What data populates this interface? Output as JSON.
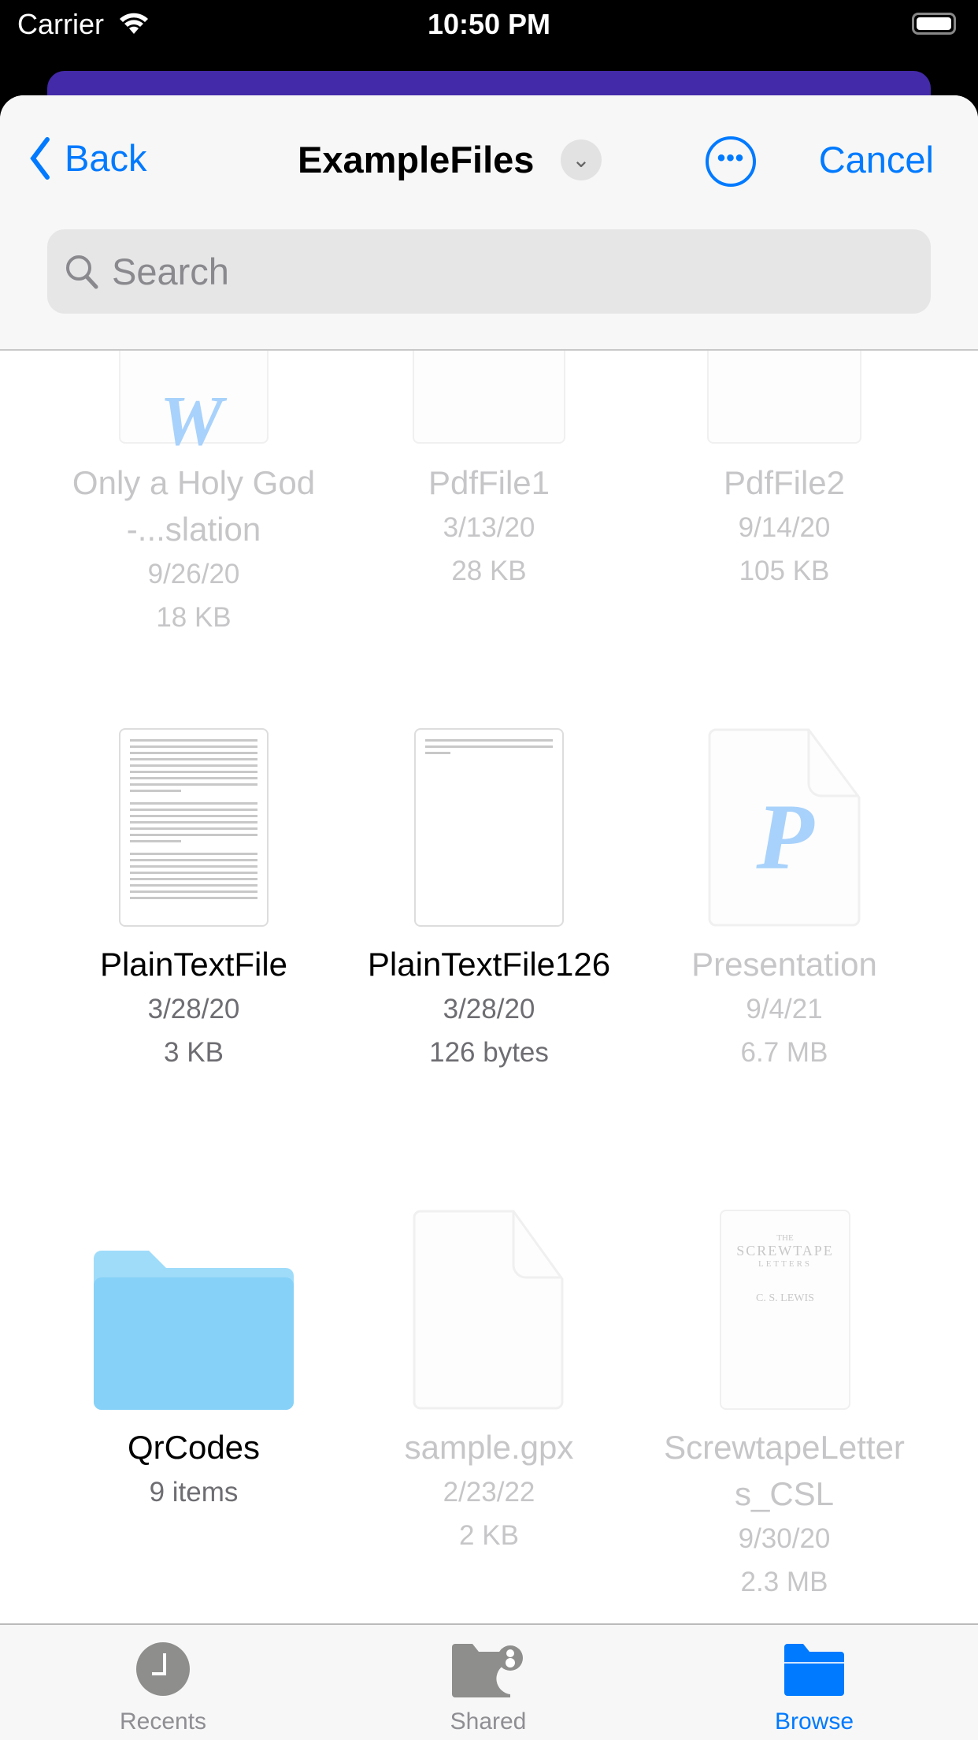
{
  "status": {
    "carrier": "Carrier",
    "time": "10:50 PM"
  },
  "header": {
    "back_label": "Back",
    "title": "ExampleFiles",
    "cancel_label": "Cancel",
    "more_icon": "ellipsis-circle-icon"
  },
  "search": {
    "placeholder": "Search",
    "value": ""
  },
  "files": [
    {
      "name": "Only a Holy God -...slation",
      "date": "9/26/20",
      "size": "18 KB",
      "enabled": false,
      "kind": "word"
    },
    {
      "name": "PdfFile1",
      "date": "3/13/20",
      "size": "28 KB",
      "enabled": false,
      "kind": "pdf"
    },
    {
      "name": "PdfFile2",
      "date": "9/14/20",
      "size": "105 KB",
      "enabled": false,
      "kind": "pdf"
    },
    {
      "name": "PlainTextFile",
      "date": "3/28/20",
      "size": "3 KB",
      "enabled": true,
      "kind": "text"
    },
    {
      "name": "PlainTextFile126",
      "date": "3/28/20",
      "size": "126 bytes",
      "enabled": true,
      "kind": "text"
    },
    {
      "name": "Presentation",
      "date": "9/4/21",
      "size": "6.7 MB",
      "enabled": false,
      "kind": "keynote"
    },
    {
      "name": "QrCodes",
      "items": "9 items",
      "enabled": true,
      "kind": "folder"
    },
    {
      "name": "sample.gpx",
      "date": "2/23/22",
      "size": "2 KB",
      "enabled": false,
      "kind": "generic"
    },
    {
      "name": "ScrewtapeLetters_CSL",
      "date": "9/30/20",
      "size": "2.3 MB",
      "enabled": false,
      "kind": "pdf",
      "cover": {
        "line1": "THE",
        "line2": "SCREWTAPE",
        "line3": "LETTERS",
        "author": "C. S. LEWIS"
      }
    }
  ],
  "tabs": [
    {
      "label": "Recents",
      "icon": "clock-icon",
      "active": false
    },
    {
      "label": "Shared",
      "icon": "shared-folder-icon",
      "active": false
    },
    {
      "label": "Browse",
      "icon": "folder-icon",
      "active": true
    }
  ],
  "colors": {
    "accent": "#007aff",
    "header_card": "#432aa8",
    "folder": "#86d1f7"
  }
}
